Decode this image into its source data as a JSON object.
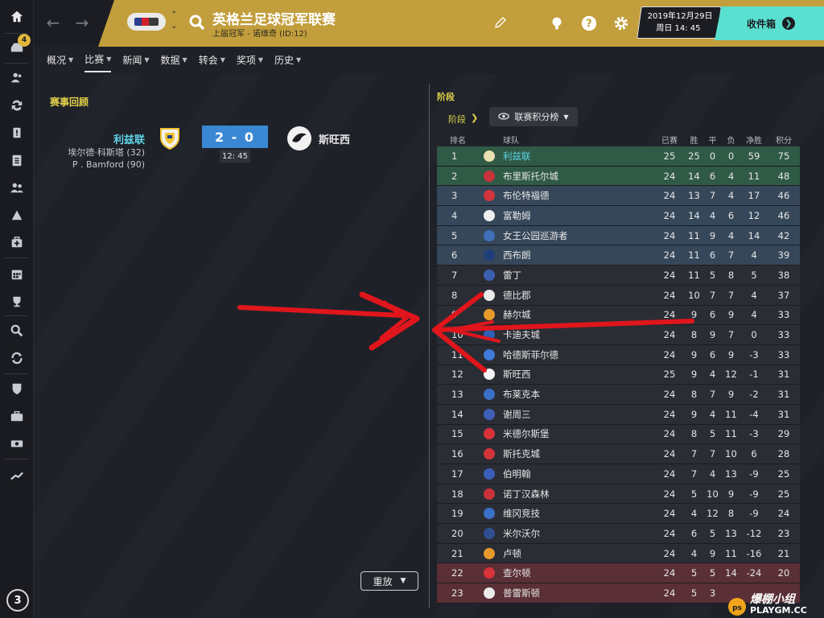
{
  "sidebar": {
    "badge_count": "4",
    "bottom_counter": "3"
  },
  "header": {
    "title": "英格兰足球冠军联赛",
    "subtitle": "上届冠军 - 诺维奇 (ID:12)",
    "date_line1": "2019年12月29日",
    "date_line2": "周日 14: 45",
    "inbox_label": "收件箱",
    "accent_color": "#c29e3c",
    "inbox_color": "#5ae0d0"
  },
  "tabs": [
    {
      "label": "概况"
    },
    {
      "label": "比赛",
      "active": true
    },
    {
      "label": "新闻"
    },
    {
      "label": "数据"
    },
    {
      "label": "转会"
    },
    {
      "label": "奖项"
    },
    {
      "label": "历史"
    }
  ],
  "match_review": {
    "title": "赛事回顾",
    "home_team": "利兹联",
    "away_team": "斯旺西",
    "score": "2 - 0",
    "time": "12: 45",
    "scorers": [
      "埃尔德·科斯塔 (32)",
      "P . Bamford (90)"
    ]
  },
  "replay_label": "重放",
  "stage_panel": {
    "title": "阶段",
    "stage_link": "阶段",
    "table_select": "联赛积分榜"
  },
  "standings": {
    "headers": {
      "rank": "排名",
      "team": "球队",
      "played": "已赛",
      "won": "胜",
      "drawn": "平",
      "lost": "负",
      "gd": "净胜",
      "pts": "积分"
    },
    "rows": [
      {
        "rank": "1",
        "team": "利兹联",
        "played": "25",
        "won": "25",
        "drawn": "0",
        "lost": "0",
        "gd": "59",
        "pts": "75",
        "zone": "green",
        "crest": "#e8e0b0",
        "hl": true
      },
      {
        "rank": "2",
        "team": "布里斯托尔城",
        "played": "24",
        "won": "14",
        "drawn": "6",
        "lost": "4",
        "gd": "11",
        "pts": "48",
        "zone": "green",
        "crest": "#c8323a"
      },
      {
        "rank": "3",
        "team": "布伦特福德",
        "played": "24",
        "won": "13",
        "drawn": "7",
        "lost": "4",
        "gd": "17",
        "pts": "46",
        "zone": "blue",
        "crest": "#d3343b"
      },
      {
        "rank": "4",
        "team": "富勒姆",
        "played": "24",
        "won": "14",
        "drawn": "4",
        "lost": "6",
        "gd": "12",
        "pts": "46",
        "zone": "blue",
        "crest": "#efefef"
      },
      {
        "rank": "5",
        "team": "女王公园巡游者",
        "played": "24",
        "won": "11",
        "drawn": "9",
        "lost": "4",
        "gd": "14",
        "pts": "42",
        "zone": "blue",
        "crest": "#3f6fb8"
      },
      {
        "rank": "6",
        "team": "西布朗",
        "played": "24",
        "won": "11",
        "drawn": "6",
        "lost": "7",
        "gd": "4",
        "pts": "39",
        "zone": "blue",
        "crest": "#1f3f7a"
      },
      {
        "rank": "7",
        "team": "雷丁",
        "played": "24",
        "won": "11",
        "drawn": "5",
        "lost": "8",
        "gd": "5",
        "pts": "38",
        "zone": "plain",
        "crest": "#3a5fb0"
      },
      {
        "rank": "8",
        "team": "德比郡",
        "played": "24",
        "won": "10",
        "drawn": "7",
        "lost": "7",
        "gd": "4",
        "pts": "37",
        "zone": "plain",
        "crest": "#eaeaea"
      },
      {
        "rank": "9",
        "team": "赫尔城",
        "played": "24",
        "won": "9",
        "drawn": "6",
        "lost": "9",
        "gd": "4",
        "pts": "33",
        "zone": "plain",
        "crest": "#e79a2a"
      },
      {
        "rank": "10",
        "team": "卡迪夫城",
        "played": "24",
        "won": "8",
        "drawn": "9",
        "lost": "7",
        "gd": "0",
        "pts": "33",
        "zone": "plain",
        "crest": "#2f5fb8"
      },
      {
        "rank": "11",
        "team": "哈德斯菲尔德",
        "played": "24",
        "won": "9",
        "drawn": "6",
        "lost": "9",
        "gd": "-3",
        "pts": "33",
        "zone": "plain",
        "crest": "#3f7ad8"
      },
      {
        "rank": "12",
        "team": "斯旺西",
        "played": "25",
        "won": "9",
        "drawn": "4",
        "lost": "12",
        "gd": "-1",
        "pts": "31",
        "zone": "plain",
        "crest": "#f2f2f2"
      },
      {
        "rank": "13",
        "team": "布莱克本",
        "played": "24",
        "won": "8",
        "drawn": "7",
        "lost": "9",
        "gd": "-2",
        "pts": "31",
        "zone": "plain",
        "crest": "#3a70c8"
      },
      {
        "rank": "14",
        "team": "谢周三",
        "played": "24",
        "won": "9",
        "drawn": "4",
        "lost": "11",
        "gd": "-4",
        "pts": "31",
        "zone": "plain",
        "crest": "#3f5fb8"
      },
      {
        "rank": "15",
        "team": "米德尔斯堡",
        "played": "24",
        "won": "8",
        "drawn": "5",
        "lost": "11",
        "gd": "-3",
        "pts": "29",
        "zone": "plain",
        "crest": "#d8323a"
      },
      {
        "rank": "16",
        "team": "斯托克城",
        "played": "24",
        "won": "7",
        "drawn": "7",
        "lost": "10",
        "gd": "6",
        "pts": "28",
        "zone": "plain",
        "crest": "#d3343b"
      },
      {
        "rank": "17",
        "team": "伯明翰",
        "played": "24",
        "won": "7",
        "drawn": "4",
        "lost": "13",
        "gd": "-9",
        "pts": "25",
        "zone": "plain",
        "crest": "#3a5fb8"
      },
      {
        "rank": "18",
        "team": "诺丁汉森林",
        "played": "24",
        "won": "5",
        "drawn": "10",
        "lost": "9",
        "gd": "-9",
        "pts": "25",
        "zone": "plain",
        "crest": "#c8323a"
      },
      {
        "rank": "19",
        "team": "维冈竞技",
        "played": "24",
        "won": "4",
        "drawn": "12",
        "lost": "8",
        "gd": "-9",
        "pts": "24",
        "zone": "plain",
        "crest": "#3a70c8"
      },
      {
        "rank": "20",
        "team": "米尔沃尔",
        "played": "24",
        "won": "6",
        "drawn": "5",
        "lost": "13",
        "gd": "-12",
        "pts": "23",
        "zone": "plain",
        "crest": "#2f4f90"
      },
      {
        "rank": "21",
        "team": "卢顿",
        "played": "24",
        "won": "4",
        "drawn": "9",
        "lost": "11",
        "gd": "-16",
        "pts": "21",
        "zone": "plain",
        "crest": "#e79a2a"
      },
      {
        "rank": "22",
        "team": "查尔顿",
        "played": "24",
        "won": "5",
        "drawn": "5",
        "lost": "14",
        "gd": "-24",
        "pts": "20",
        "zone": "red",
        "crest": "#d8323a"
      },
      {
        "rank": "23",
        "team": "普雷斯顿",
        "played": "24",
        "won": "5",
        "drawn": "3",
        "lost": "",
        "gd": "",
        "pts": "",
        "zone": "red",
        "crest": "#eaeaea"
      }
    ]
  },
  "watermark": {
    "text": "爆棚小组",
    "sub": "PLAYGM.CC"
  }
}
